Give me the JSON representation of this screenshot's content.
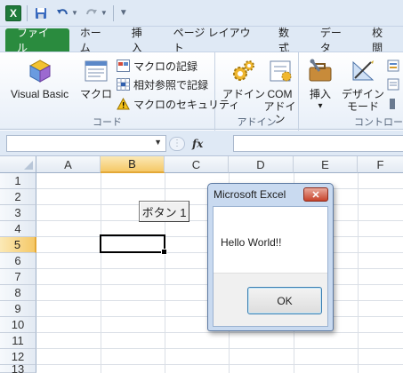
{
  "qat": {
    "app_logo": "X",
    "save_icon": "save-icon",
    "undo_icon": "undo-icon",
    "redo_icon": "redo-icon"
  },
  "tabs": [
    "ファイル",
    "ホーム",
    "挿入",
    "ページ レイアウト",
    "数式",
    "データ",
    "校閲"
  ],
  "ribbon": {
    "code_group": {
      "label": "コード",
      "visual_basic": "Visual Basic",
      "macro": "マクロ",
      "record_macro": "マクロの記録",
      "relative_ref": "相対参照で記録",
      "macro_security": "マクロのセキュリティ"
    },
    "addin_group": {
      "label": "アドイン",
      "addin": "アドイン",
      "com_addin_line1": "COM",
      "com_addin_line2": "アドイン"
    },
    "control_group": {
      "label": "コントロー",
      "insert": "挿入",
      "insert_arrow": "▾",
      "design_mode_line1": "デザイン",
      "design_mode_line2": "モード"
    }
  },
  "formula_bar": {
    "name_box": "",
    "fx": "fx",
    "value": ""
  },
  "grid": {
    "columns": [
      "A",
      "B",
      "C",
      "D",
      "E",
      "F"
    ],
    "rows": [
      "1",
      "2",
      "3",
      "4",
      "5",
      "6",
      "7",
      "8",
      "9",
      "10",
      "11",
      "12",
      "13"
    ],
    "selected_column": "B",
    "selected_row": "5"
  },
  "form_button": {
    "label": "ボタン 1"
  },
  "message_box": {
    "title": "Microsoft Excel",
    "close": "✕",
    "message": "Hello World!!",
    "ok": "OK"
  }
}
